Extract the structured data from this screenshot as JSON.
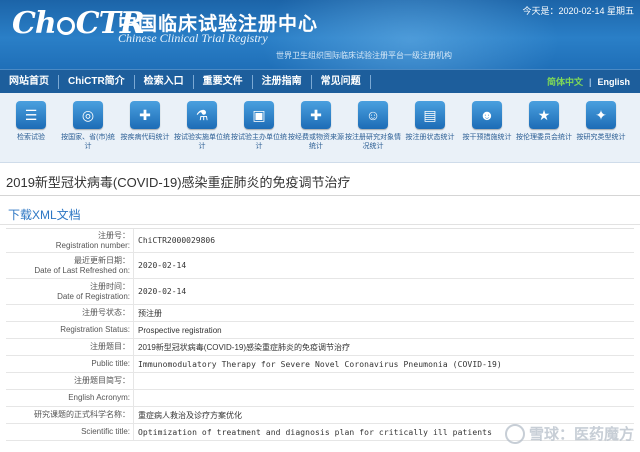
{
  "header": {
    "logo_text": "ChiCTR",
    "title_cn": "中国临床试验注册中心",
    "title_en": "Chinese Clinical Trial Registry",
    "subline": "世界卫生组织国际临床试验注册平台一级注册机构",
    "today": "今天是：2020-02-14 星期五"
  },
  "nav": {
    "items": [
      "网站首页",
      "ChiCTR简介",
      "检索入口",
      "重要文件",
      "注册指南",
      "常见问题"
    ],
    "lang_cn": "简体中文",
    "lang_sep": "|",
    "lang_en": "English"
  },
  "icons": [
    {
      "label": "检索试验",
      "glyph": "☰",
      "icon": "list-icon"
    },
    {
      "label": "按国家、省(市)统计",
      "glyph": "◎",
      "icon": "globe-icon"
    },
    {
      "label": "按疾病代码统计",
      "glyph": "✚",
      "icon": "dna-icon"
    },
    {
      "label": "按试验实施单位统计",
      "glyph": "⚗",
      "icon": "flask-icon"
    },
    {
      "label": "按试验主办单位统计",
      "glyph": "▣",
      "icon": "hospital-icon"
    },
    {
      "label": "按经费或物资来源统计",
      "glyph": "✚",
      "icon": "medkit-icon"
    },
    {
      "label": "按注册研究对象情况统计",
      "glyph": "☺",
      "icon": "people-icon"
    },
    {
      "label": "按注册状态统计",
      "glyph": "▤",
      "icon": "status-icon"
    },
    {
      "label": "按干预措施统计",
      "glyph": "☻",
      "icon": "doctor-icon"
    },
    {
      "label": "按伦理委员会统计",
      "glyph": "★",
      "icon": "star-icon"
    },
    {
      "label": "按研究类型统计",
      "glyph": "✦",
      "icon": "sparkle-icon"
    }
  ],
  "study": {
    "title": "2019新型冠状病毒(COVID-19)感染重症肺炎的免疫调节治疗",
    "xml_link": "下载XML文档"
  },
  "fields": [
    {
      "cn": "注册号：",
      "en": "Registration number:",
      "value": "ChiCTR2000029806"
    },
    {
      "cn": "最近更新日期：",
      "en": "Date of Last Refreshed on:",
      "value": "2020-02-14"
    },
    {
      "cn": "注册时间：",
      "en": "Date of Registration:",
      "value": "2020-02-14"
    },
    {
      "cn": "注册号状态：",
      "en": "",
      "value": "预注册"
    },
    {
      "cn": "",
      "en": "Registration Status:",
      "value": "Prospective registration"
    },
    {
      "cn": "注册题目：",
      "en": "",
      "value": "2019新型冠状病毒(COVID-19)感染重症肺炎的免疫调节治疗"
    },
    {
      "cn": "",
      "en": "Public title:",
      "value": "Immunomodulatory Therapy for Severe Novel Coronavirus Pneumonia (COVID-19)"
    },
    {
      "cn": "注册题目简写：",
      "en": "",
      "value": ""
    },
    {
      "cn": "",
      "en": "English Acronym:",
      "value": ""
    },
    {
      "cn": "研究课题的正式科学名称：",
      "en": "",
      "value": "重症病人救治及诊疗方案优化"
    },
    {
      "cn": "",
      "en": "Scientific title:",
      "value": "Optimization of treatment and diagnosis plan for critically ill patients"
    }
  ],
  "watermark": "雪球：医药魔方"
}
